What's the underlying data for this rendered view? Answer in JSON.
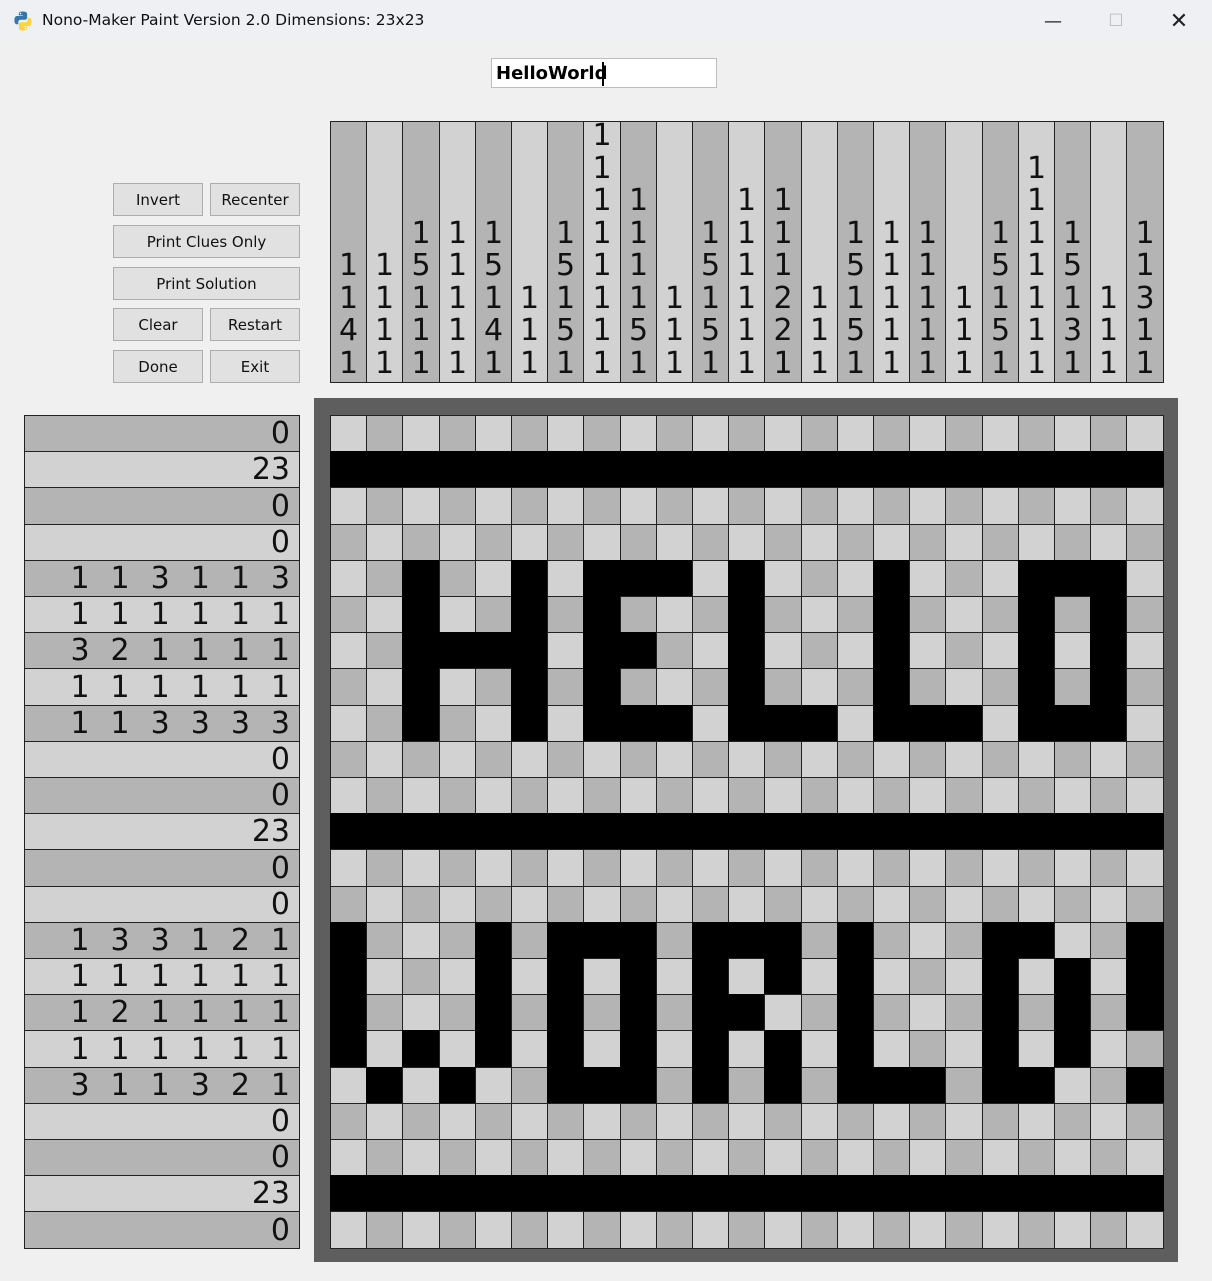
{
  "window": {
    "title": "Nono-Maker Paint Version 2.0 Dimensions: 23x23",
    "minimize": "—",
    "maximize": "☐",
    "close": "✕"
  },
  "name_field": {
    "value": "HelloWorld"
  },
  "buttons": {
    "invert": "Invert",
    "recenter": "Recenter",
    "print_clues": "Print Clues Only",
    "print_solution": "Print Solution",
    "clear": "Clear",
    "restart": "Restart",
    "done": "Done",
    "exit": "Exit"
  },
  "column_clues": [
    [
      "1",
      "1",
      "4",
      "1"
    ],
    [
      "1",
      "1",
      "1",
      "1"
    ],
    [
      "1",
      "5",
      "1",
      "1",
      "1"
    ],
    [
      "1",
      "1",
      "1",
      "1",
      "1"
    ],
    [
      "1",
      "5",
      "1",
      "4",
      "1"
    ],
    [
      "1",
      "1",
      "1"
    ],
    [
      "1",
      "5",
      "1",
      "5",
      "1"
    ],
    [
      "1",
      "1",
      "1",
      "1",
      "1",
      "1",
      "1",
      "1"
    ],
    [
      "1",
      "1",
      "1",
      "1",
      "5",
      "1"
    ],
    [
      "1",
      "1",
      "1"
    ],
    [
      "1",
      "5",
      "1",
      "5",
      "1"
    ],
    [
      "1",
      "1",
      "1",
      "1",
      "1",
      "1"
    ],
    [
      "1",
      "1",
      "1",
      "2",
      "2",
      "1"
    ],
    [
      "1",
      "1",
      "1"
    ],
    [
      "1",
      "5",
      "1",
      "5",
      "1"
    ],
    [
      "1",
      "1",
      "1",
      "1",
      "1"
    ],
    [
      "1",
      "1",
      "1",
      "1",
      "1"
    ],
    [
      "1",
      "1",
      "1"
    ],
    [
      "1",
      "5",
      "1",
      "5",
      "1"
    ],
    [
      "1",
      "1",
      "1",
      "1",
      "1",
      "1",
      "1"
    ],
    [
      "1",
      "5",
      "1",
      "3",
      "1"
    ],
    [
      "1",
      "1",
      "1"
    ],
    [
      "1",
      "1",
      "3",
      "1",
      "1"
    ]
  ],
  "row_clues": [
    [
      "0"
    ],
    [
      "23"
    ],
    [
      "0"
    ],
    [
      "0"
    ],
    [
      "1",
      "1",
      "3",
      "1",
      "1",
      "3"
    ],
    [
      "1",
      "1",
      "1",
      "1",
      "1",
      "1"
    ],
    [
      "3",
      "2",
      "1",
      "1",
      "1",
      "1"
    ],
    [
      "1",
      "1",
      "1",
      "1",
      "1",
      "1"
    ],
    [
      "1",
      "1",
      "3",
      "3",
      "3",
      "3"
    ],
    [
      "0"
    ],
    [
      "0"
    ],
    [
      "23"
    ],
    [
      "0"
    ],
    [
      "0"
    ],
    [
      "1",
      "3",
      "3",
      "1",
      "2",
      "1"
    ],
    [
      "1",
      "1",
      "1",
      "1",
      "1",
      "1"
    ],
    [
      "1",
      "2",
      "1",
      "1",
      "1",
      "1"
    ],
    [
      "1",
      "1",
      "1",
      "1",
      "1",
      "1"
    ],
    [
      "3",
      "1",
      "1",
      "3",
      "2",
      "1"
    ],
    [
      "0"
    ],
    [
      "0"
    ],
    [
      "23"
    ],
    [
      "0"
    ]
  ],
  "grid_rows": [
    ".......................",
    "#######################",
    ".......................",
    ".......................",
    "..#..#.###.#...#...###.",
    "..#..#.#...#...#...#.#.",
    "..####.##..#...#...#.#.",
    "..#..#.#...#...#...#.#.",
    "..#..#.###.###.###.###.",
    ".......................",
    ".......................",
    "#######################",
    ".......................",
    ".......................",
    "#...#.###.###.#...##..#",
    "#...#.#.#.#.#.#...#.#.#",
    "#...#.#.#.##..#...#.#.#",
    "#.#.#.#.#.#.#.#...#.#..",
    ".#.#..###.#.#.###.##..#",
    ".......................",
    ".......................",
    "#######################",
    "......................."
  ],
  "colors": {
    "filled": "#000000",
    "light_cell": "#d2d2d2",
    "dark_cell": "#b4b4b4",
    "frame": "#5e5e5e",
    "clue_light": "#d2d2d2",
    "clue_dark": "#b4b4b4"
  }
}
